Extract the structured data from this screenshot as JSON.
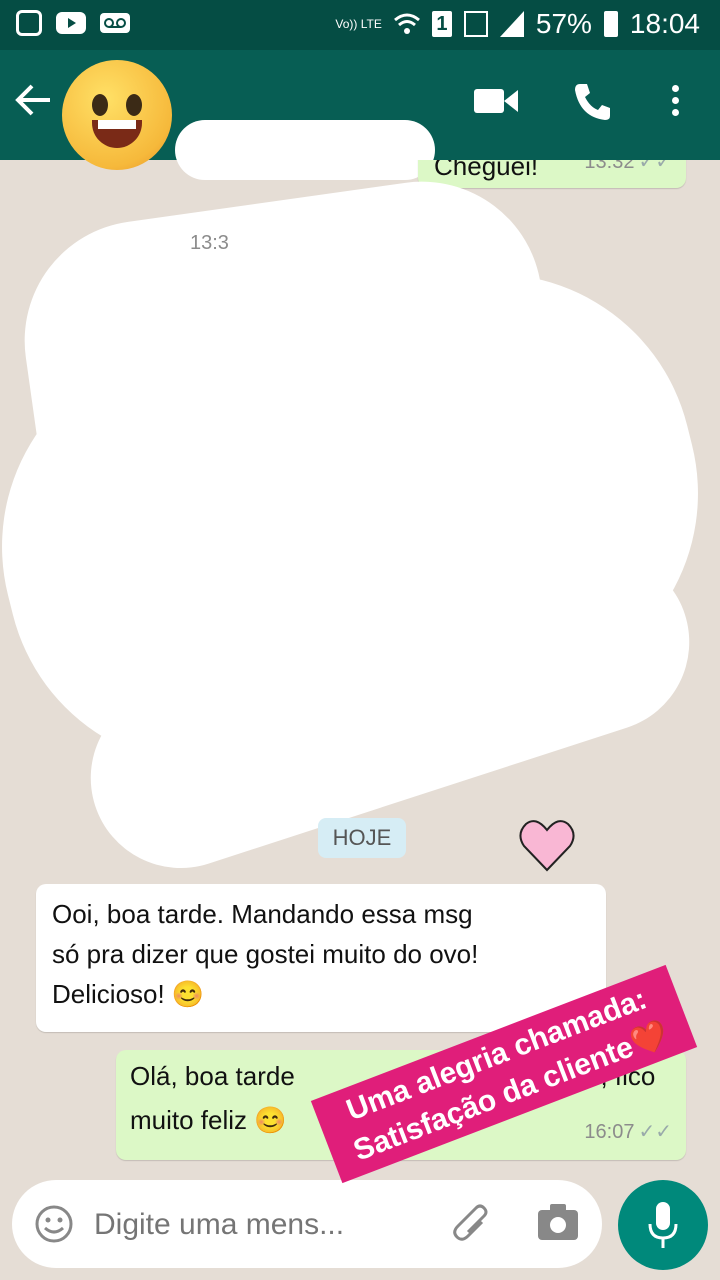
{
  "status_bar": {
    "lte_label": "Vo)) LTE",
    "sim_label": "1",
    "battery": "57%",
    "time": "18:04"
  },
  "chat": {
    "top_message": {
      "text": "Cheguei!",
      "time": "13:32"
    },
    "partial_time": "13:3",
    "date_chip": "HOJE",
    "incoming": {
      "lines": [
        "Ooi, boa tarde. Mandando essa msg",
        "só pra dizer que gostei muito do ovo!",
        "Delicioso! 😊"
      ]
    },
    "outgoing": {
      "line1": "Olá, boa tarde",
      "line1_end": "o, fico",
      "line2": "muito feliz 😊",
      "line2_end": ".",
      "time": "16:07"
    }
  },
  "sticker": {
    "line1": "Uma alegria chamada:",
    "line2": "Satisfação da cliente❤️"
  },
  "input": {
    "placeholder": "Digite uma mens..."
  },
  "colors": {
    "header": "#075e54",
    "statusbar": "#054d44",
    "outgoing_bubble": "#dcf8c6",
    "sticker": "#e01e7a",
    "fab": "#00897b"
  },
  "icons": [
    "instagram-icon",
    "youtube-icon",
    "voicemail-icon",
    "wifi-icon",
    "signal-icon",
    "battery-icon",
    "back-arrow-icon",
    "video-call-icon",
    "phone-icon",
    "more-vert-icon",
    "emoji-icon",
    "attach-icon",
    "camera-icon",
    "mic-icon"
  ]
}
